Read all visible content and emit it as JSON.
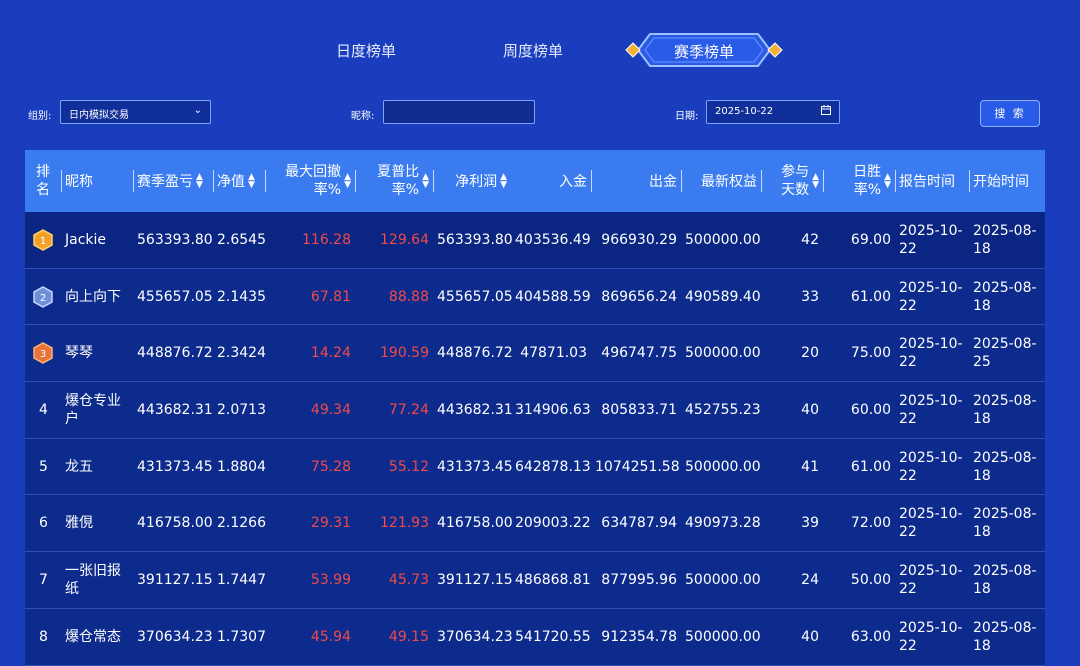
{
  "tabs": {
    "daily": "日度榜单",
    "weekly": "周度榜单",
    "season": "赛季榜单"
  },
  "filters": {
    "group_label": "组别:",
    "group_value": "日内模拟交易",
    "nickname_label": "昵称:",
    "nickname_value": "",
    "date_label": "日期:",
    "date_value": "2025-10-22",
    "search_label": "搜 索"
  },
  "columns": {
    "rank": "排名",
    "nickname": "昵称",
    "season_pl": "赛季盈亏",
    "net_value": "净值",
    "max_drawdown": "最大回撤率%",
    "sharpe": "夏普比率%",
    "net_profit": "净利润",
    "deposit": "入金",
    "withdraw": "出金",
    "latest_equity": "最新权益",
    "days": "参与天数",
    "win_rate": "日胜率%",
    "report_time": "报告时间",
    "start_time": "开始时间"
  },
  "colors": {
    "background": "#1a3dbd",
    "header": "#3a7cf0",
    "row": "#0d2b8c",
    "negative_red": "#f04a4a"
  },
  "rows": [
    {
      "rank": "1",
      "medal": "gold",
      "nickname": "Jackie",
      "season_pl": "563393.80",
      "net_value": "2.6545",
      "max_drawdown": "116.28",
      "sharpe": "129.64",
      "net_profit": "563393.80",
      "deposit": "403536.49",
      "withdraw": "966930.29",
      "latest_equity": "500000.00",
      "days": "42",
      "win_rate": "69.00",
      "report_time": "2025-10-22",
      "start_time": "2025-08-18"
    },
    {
      "rank": "2",
      "medal": "silver",
      "nickname": "向上向下",
      "season_pl": "455657.05",
      "net_value": "2.1435",
      "max_drawdown": "67.81",
      "sharpe": "88.88",
      "net_profit": "455657.05",
      "deposit": "404588.59",
      "withdraw": "869656.24",
      "latest_equity": "490589.40",
      "days": "33",
      "win_rate": "61.00",
      "report_time": "2025-10-22",
      "start_time": "2025-08-18"
    },
    {
      "rank": "3",
      "medal": "bronze",
      "nickname": "琴琴",
      "season_pl": "448876.72",
      "net_value": "2.3424",
      "max_drawdown": "14.24",
      "sharpe": "190.59",
      "net_profit": "448876.72",
      "deposit": "47871.03",
      "withdraw": "496747.75",
      "latest_equity": "500000.00",
      "days": "20",
      "win_rate": "75.00",
      "report_time": "2025-10-22",
      "start_time": "2025-08-25"
    },
    {
      "rank": "4",
      "medal": "",
      "nickname": "爆仓专业户",
      "season_pl": "443682.31",
      "net_value": "2.0713",
      "max_drawdown": "49.34",
      "sharpe": "77.24",
      "net_profit": "443682.31",
      "deposit": "314906.63",
      "withdraw": "805833.71",
      "latest_equity": "452755.23",
      "days": "40",
      "win_rate": "60.00",
      "report_time": "2025-10-22",
      "start_time": "2025-08-18"
    },
    {
      "rank": "5",
      "medal": "",
      "nickname": "龙五",
      "season_pl": "431373.45",
      "net_value": "1.8804",
      "max_drawdown": "75.28",
      "sharpe": "55.12",
      "net_profit": "431373.45",
      "deposit": "642878.13",
      "withdraw": "1074251.58",
      "latest_equity": "500000.00",
      "days": "41",
      "win_rate": "61.00",
      "report_time": "2025-10-22",
      "start_time": "2025-08-18"
    },
    {
      "rank": "6",
      "medal": "",
      "nickname": "雅俔",
      "season_pl": "416758.00",
      "net_value": "2.1266",
      "max_drawdown": "29.31",
      "sharpe": "121.93",
      "net_profit": "416758.00",
      "deposit": "209003.22",
      "withdraw": "634787.94",
      "latest_equity": "490973.28",
      "days": "39",
      "win_rate": "72.00",
      "report_time": "2025-10-22",
      "start_time": "2025-08-18"
    },
    {
      "rank": "7",
      "medal": "",
      "nickname": "一张旧报纸",
      "season_pl": "391127.15",
      "net_value": "1.7447",
      "max_drawdown": "53.99",
      "sharpe": "45.73",
      "net_profit": "391127.15",
      "deposit": "486868.81",
      "withdraw": "877995.96",
      "latest_equity": "500000.00",
      "days": "24",
      "win_rate": "50.00",
      "report_time": "2025-10-22",
      "start_time": "2025-08-18"
    },
    {
      "rank": "8",
      "medal": "",
      "nickname": "爆仓常态",
      "season_pl": "370634.23",
      "net_value": "1.7307",
      "max_drawdown": "45.94",
      "sharpe": "49.15",
      "net_profit": "370634.23",
      "deposit": "541720.55",
      "withdraw": "912354.78",
      "latest_equity": "500000.00",
      "days": "40",
      "win_rate": "63.00",
      "report_time": "2025-10-22",
      "start_time": "2025-08-18"
    }
  ]
}
